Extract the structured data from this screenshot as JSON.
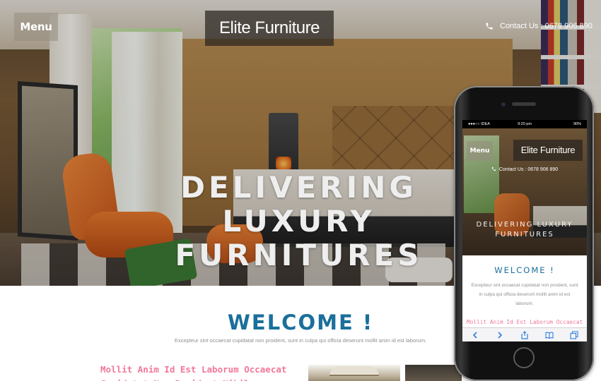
{
  "header": {
    "menu_label": "Menu",
    "brand_name": "Elite Furniture",
    "contact_text": "Contact Us : 0678 906 890"
  },
  "hero": {
    "headline_line1": "DELIVERING LUXURY",
    "headline_line2": "FURNITURES"
  },
  "welcome": {
    "title": "WELCOME !",
    "text": "Excepteur sint occaecat cupidatat non proident, sunt in culpa qui officia deserunt mollit anim id est laborum."
  },
  "article": {
    "heading": "Mollit Anim Id Est Laborum Occaecat Cupidatat Non Proident Nihil"
  },
  "phone": {
    "statusbar": {
      "carrier": "●●●○○ IDEA",
      "time": "9:20 pm",
      "battery": "90%"
    },
    "menu_label": "Menu",
    "brand_name": "Elite Furniture",
    "contact_text": "Contact Us : 0678 906 890",
    "headline_line1": "DELIVERING LUXURY",
    "headline_line2": "FURNITURES",
    "welcome_title": "WELCOME !",
    "welcome_text": "Excepteur sint occaecat cupidatat non proident, sunt in culpa qui officia deserunt mollit anim id est laborum.",
    "article_heading": "Mollit Anim Id Est Laborum Occaecat",
    "toolbar_icons": [
      "back-icon",
      "forward-icon",
      "share-icon",
      "bookmarks-icon",
      "tabs-icon"
    ]
  },
  "colors": {
    "welcome_blue": "#1b6f9b",
    "article_pink": "#f0789a",
    "body_gray": "#8e8e8e",
    "ios_blue": "#2f7fe0"
  }
}
